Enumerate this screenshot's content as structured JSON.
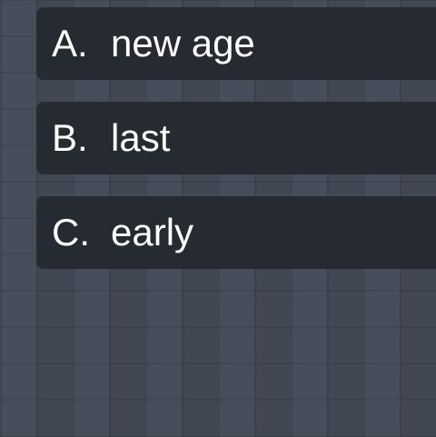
{
  "quiz": {
    "options": [
      {
        "letter": "A.",
        "text": "new age"
      },
      {
        "letter": "B.",
        "text": "last"
      },
      {
        "letter": "C.",
        "text": "early"
      }
    ]
  },
  "colors": {
    "background": "#434a57",
    "option_background": "#262a31",
    "text": "#ffffff"
  }
}
